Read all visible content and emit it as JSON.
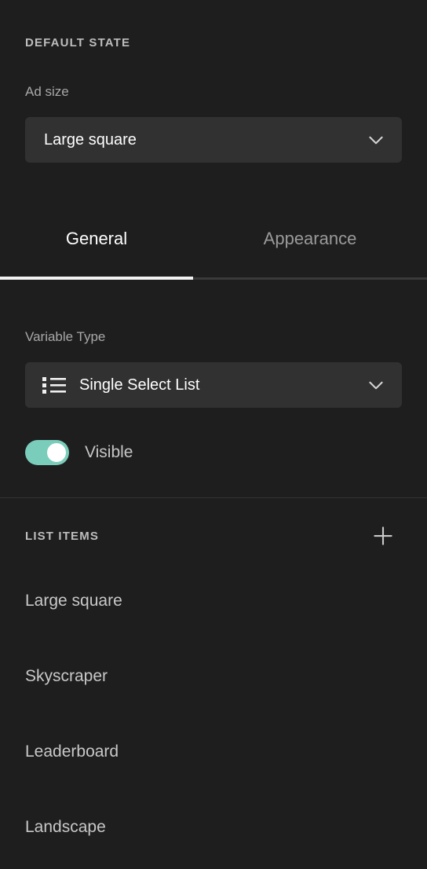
{
  "panel": {
    "background_color": "#1e1e1e",
    "accent_color": "#7acdba"
  },
  "default_state": {
    "header": "DEFAULT STATE",
    "ad_size": {
      "label": "Ad size",
      "value": "Large square",
      "chevron_icon": "chevron-down-icon"
    }
  },
  "tabs": [
    {
      "label": "General",
      "active": true
    },
    {
      "label": "Appearance",
      "active": false
    }
  ],
  "general": {
    "variable_type": {
      "label": "Variable Type",
      "value": "Single Select List",
      "left_icon": "bulleted-list-icon",
      "chevron_icon": "chevron-down-icon"
    },
    "visible_toggle": {
      "label": "Visible",
      "state": "on"
    }
  },
  "list_items": {
    "header": "LIST ITEMS",
    "add_icon": "plus-icon",
    "items": [
      {
        "label": "Large square"
      },
      {
        "label": "Skyscraper"
      },
      {
        "label": "Leaderboard"
      },
      {
        "label": "Landscape"
      }
    ]
  }
}
